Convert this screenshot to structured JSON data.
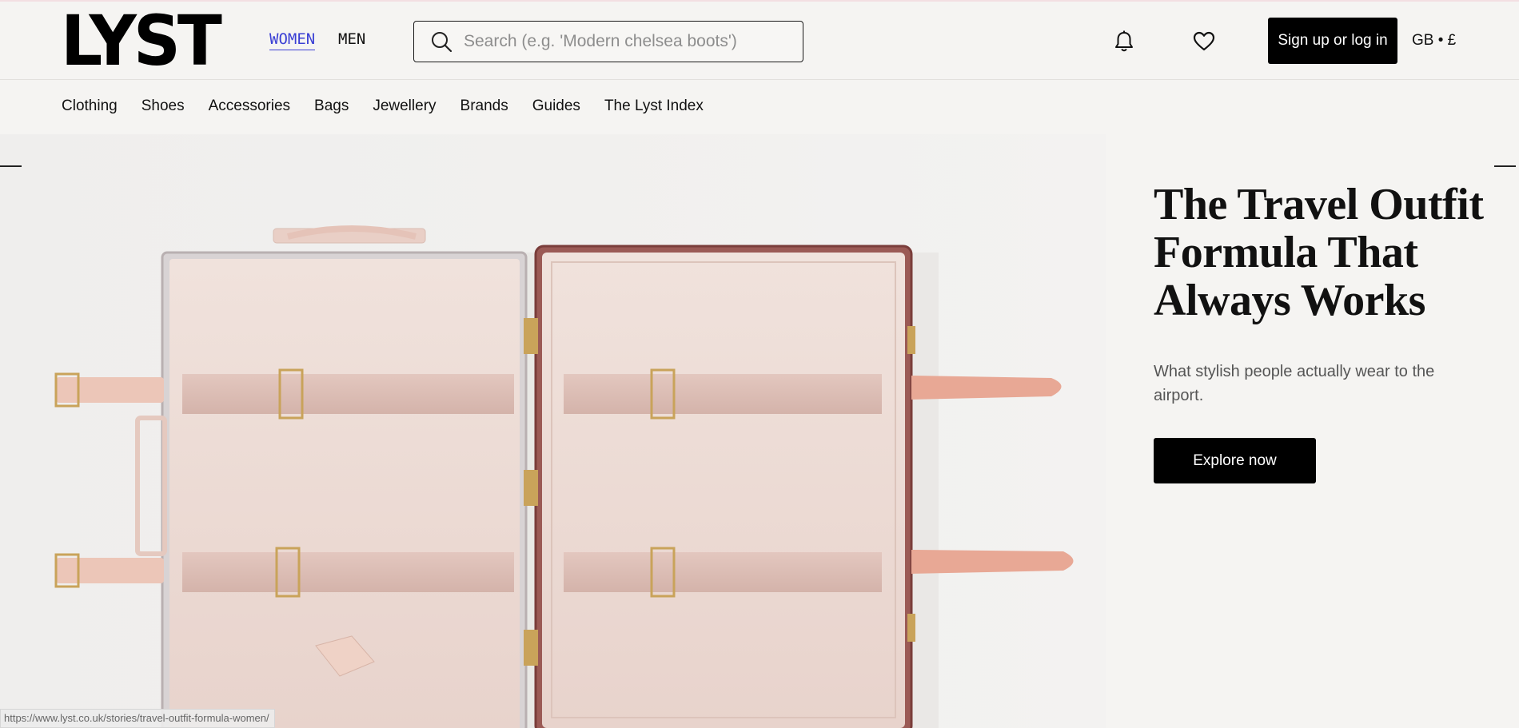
{
  "brand": {
    "logo_text": "LYST"
  },
  "gender_tabs": [
    {
      "label": "WOMEN",
      "active": true
    },
    {
      "label": "MEN",
      "active": false
    }
  ],
  "search": {
    "placeholder": "Search (e.g. 'Modern chelsea boots')",
    "value": ""
  },
  "header": {
    "notifications_icon": "bell-icon",
    "wishlist_icon": "heart-icon",
    "signup_label": "Sign up or log in",
    "locale_label": "GB • £"
  },
  "nav": {
    "items": [
      "Clothing",
      "Shoes",
      "Accessories",
      "Bags",
      "Jewellery",
      "Brands",
      "Guides",
      "The Lyst Index"
    ]
  },
  "hero": {
    "title": "The Travel Outfit Formula That Always Works",
    "subtitle": "What stylish people actually wear to the airport.",
    "cta_label": "Explore now",
    "image_description_icon": "open-suitcase-image"
  },
  "status_bar": {
    "url": "https://www.lyst.co.uk/stories/travel-outfit-formula-women/"
  },
  "colors": {
    "background": "#f5f4f2",
    "active_tab": "#3a3fd4",
    "button_bg": "#000000",
    "suitcase_lining": "#ecd8d2",
    "strap": "#e8b6a3"
  }
}
